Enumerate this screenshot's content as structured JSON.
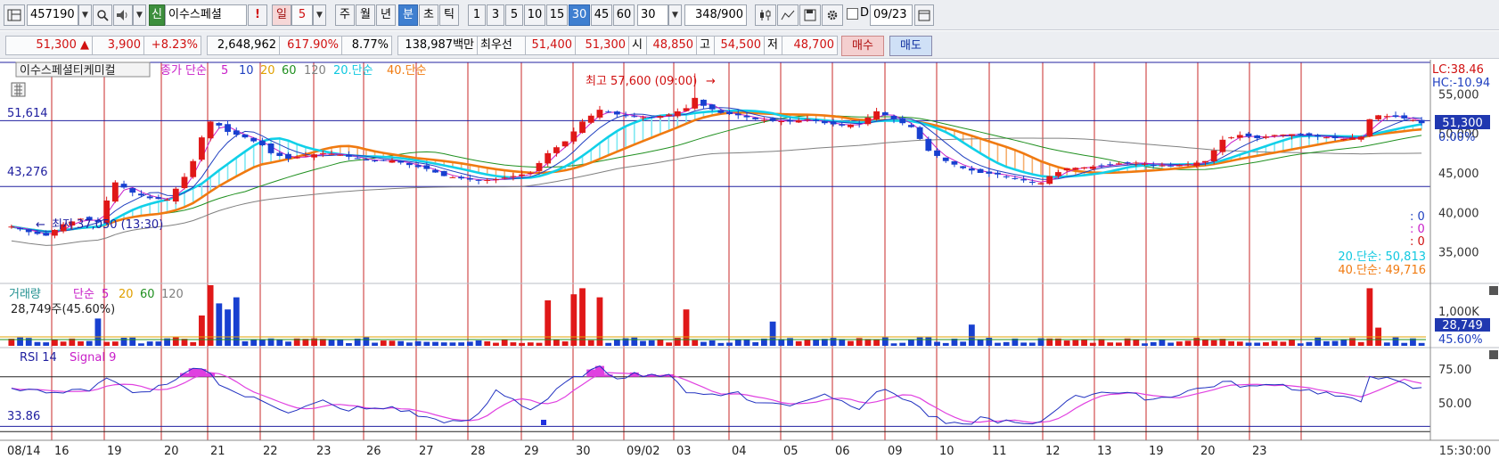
{
  "toolbar": {
    "stock_code": "457190",
    "stock_name": "이수스페셜티케미컬",
    "stock_name_short": "이수스페셜",
    "name_tag": "신",
    "alert": "!",
    "period_unit": "일",
    "period_value": "5",
    "periods": [
      "주",
      "월",
      "년",
      "분",
      "초",
      "틱"
    ],
    "minute_options": [
      "1",
      "3",
      "5",
      "10",
      "15",
      "30",
      "45",
      "60"
    ],
    "selected_minute": "30",
    "count_value": "30",
    "count_display": "348",
    "count_total": "/900",
    "checkbox_label": "D",
    "date_value": "09/23"
  },
  "quote": {
    "price": "51,300",
    "arrow": "▲",
    "change": "3,900",
    "change_pct": "+8.23%",
    "volume": "2,648,962",
    "volume_ratio": "617.90%",
    "turnover": "8.77%",
    "amount": "138,987백만",
    "best_label": "최우선",
    "ask": "51,400",
    "bid": "51,300",
    "open_label": "시",
    "open": "48,850",
    "high_label": "고",
    "high": "54,500",
    "low_label": "저",
    "low": "48,700",
    "buy_label": "매수",
    "sell_label": "매도"
  },
  "price_panel": {
    "legend": {
      "name": "이수스페셜티케미컬",
      "ma_label": "종가 단순",
      "ma_periods": [
        "5",
        "10",
        "20",
        "60",
        "120"
      ],
      "ma_colors": [
        "#c81ec8",
        "#2040c0",
        "#e0a000",
        "#209020",
        "#808080"
      ],
      "ma20_label": "20.단순",
      "ma40_label": "40.단순"
    },
    "lc_label": "LC:38.46",
    "hc_label": "HC:-10.94",
    "h_line_levels": [
      {
        "label": "51,614",
        "value": 51614
      },
      {
        "label": "43,276",
        "value": 43276
      }
    ],
    "current_price_label": "51,300",
    "current_pct_label": "0.00%",
    "y_axis_ticks": [
      "55,000",
      "50,000",
      "45,000",
      "40,000",
      "35,000"
    ],
    "annotation_high": "최고 57,600 (09:00)",
    "annotation_high_arrow": "→",
    "annotation_low": "최저 37,050 (13:30)",
    "annotation_low_arrow": "←",
    "right_markers": [
      ": 0",
      ": 0",
      ": 0"
    ],
    "ma20_value_label": "20.단순: 50,813",
    "ma40_value_label": "40.단순: 49,716"
  },
  "volume_panel": {
    "legend": {
      "label": "거래량",
      "ma_label": "단순",
      "ma_periods": [
        "5",
        "20",
        "60",
        "120"
      ],
      "ma_colors": [
        "#c81ec8",
        "#e0a000",
        "#209020",
        "#808080"
      ]
    },
    "current_volume": "28,749주(45.60%)",
    "y_axis_tick": "1,000K",
    "current_volume_label": "28,749",
    "current_pct_label": "45.60%"
  },
  "rsi_panel": {
    "legend": {
      "rsi_label": "RSI 14",
      "signal_label": "Signal 9"
    },
    "current_value": "33.86",
    "y_axis_ticks": [
      "75.00",
      "50.00"
    ]
  },
  "x_axis": {
    "labels": [
      "08/14",
      "16",
      "19",
      "20",
      "21",
      "22",
      "23",
      "26",
      "27",
      "28",
      "29",
      "30",
      "09/02",
      "03",
      "04",
      "05",
      "06",
      "09",
      "10",
      "11",
      "12",
      "13",
      "19",
      "20",
      "23"
    ],
    "time_label": "15:30:00"
  },
  "chart_data": {
    "type": "candlestick",
    "series": [
      {
        "name": "종가 단순 5"
      },
      {
        "name": "종가 단순 10"
      },
      {
        "name": "종가 단순 20"
      },
      {
        "name": "종가 단순 60"
      },
      {
        "name": "종가 단순 120"
      },
      {
        "name": "20.단순"
      },
      {
        "name": "40.단순"
      }
    ],
    "price_path": [
      [
        0,
        38200
      ],
      [
        2,
        37500
      ],
      [
        4,
        37050
      ],
      [
        6,
        38500
      ],
      [
        8,
        39200
      ],
      [
        10,
        38800
      ],
      [
        11,
        41500
      ],
      [
        12,
        43800
      ],
      [
        14,
        42500
      ],
      [
        16,
        41800
      ],
      [
        18,
        41600
      ],
      [
        19,
        43000
      ],
      [
        20,
        44500
      ],
      [
        21,
        46500
      ],
      [
        22,
        49500
      ],
      [
        23,
        51500
      ],
      [
        24,
        51000
      ],
      [
        25,
        50200
      ],
      [
        27,
        49500
      ],
      [
        29,
        48500
      ],
      [
        30,
        47500
      ],
      [
        32,
        46800
      ],
      [
        34,
        47200
      ],
      [
        36,
        47500
      ],
      [
        38,
        47300
      ],
      [
        40,
        46800
      ],
      [
        42,
        46500
      ],
      [
        44,
        46600
      ],
      [
        46,
        46000
      ],
      [
        48,
        45500
      ],
      [
        50,
        44600
      ],
      [
        52,
        44300
      ],
      [
        54,
        44000
      ],
      [
        56,
        44200
      ],
      [
        58,
        44600
      ],
      [
        60,
        45000
      ],
      [
        62,
        47500
      ],
      [
        64,
        49000
      ],
      [
        66,
        51500
      ],
      [
        68,
        53000
      ],
      [
        70,
        52400
      ],
      [
        72,
        52100
      ],
      [
        74,
        52000
      ],
      [
        76,
        52400
      ],
      [
        78,
        53200
      ],
      [
        79,
        54500
      ],
      [
        80,
        53500
      ],
      [
        82,
        52600
      ],
      [
        84,
        52300
      ],
      [
        86,
        51800
      ],
      [
        88,
        51600
      ],
      [
        90,
        51500
      ],
      [
        92,
        51800
      ],
      [
        94,
        51300
      ],
      [
        96,
        51000
      ],
      [
        98,
        51200
      ],
      [
        100,
        52800
      ],
      [
        102,
        51800
      ],
      [
        104,
        50800
      ],
      [
        105,
        49300
      ],
      [
        106,
        47800
      ],
      [
        108,
        46500
      ],
      [
        110,
        45600
      ],
      [
        112,
        45000
      ],
      [
        114,
        44800
      ],
      [
        116,
        44300
      ],
      [
        118,
        43800
      ],
      [
        119,
        43700
      ],
      [
        120,
        44600
      ],
      [
        122,
        45600
      ],
      [
        124,
        45700
      ],
      [
        126,
        45900
      ],
      [
        128,
        46200
      ],
      [
        130,
        46300
      ],
      [
        132,
        46000
      ],
      [
        134,
        45900
      ],
      [
        136,
        46100
      ],
      [
        138,
        46500
      ],
      [
        140,
        49200
      ],
      [
        142,
        49800
      ],
      [
        144,
        49400
      ],
      [
        146,
        49800
      ],
      [
        148,
        49900
      ],
      [
        150,
        49700
      ],
      [
        152,
        49500
      ],
      [
        154,
        49300
      ],
      [
        156,
        49600
      ],
      [
        157,
        51800
      ],
      [
        158,
        52300
      ],
      [
        160,
        52100
      ],
      [
        162,
        51700
      ],
      [
        163,
        51300
      ]
    ],
    "period_markers": {
      "high": 57600,
      "high_time": "09:00",
      "low": 37050,
      "low_time": "13:30"
    },
    "rsi_path": [
      [
        0,
        62
      ],
      [
        3,
        60
      ],
      [
        5,
        57
      ],
      [
        7,
        62
      ],
      [
        9,
        60
      ],
      [
        11,
        68
      ],
      [
        13,
        62
      ],
      [
        15,
        58
      ],
      [
        17,
        62
      ],
      [
        19,
        66
      ],
      [
        20,
        72
      ],
      [
        22,
        77
      ],
      [
        24,
        66
      ],
      [
        26,
        58
      ],
      [
        28,
        54
      ],
      [
        30,
        50
      ],
      [
        32,
        45
      ],
      [
        34,
        48
      ],
      [
        36,
        52
      ],
      [
        38,
        46
      ],
      [
        40,
        47
      ],
      [
        42,
        46
      ],
      [
        44,
        48
      ],
      [
        46,
        44
      ],
      [
        48,
        40
      ],
      [
        50,
        38
      ],
      [
        52,
        36
      ],
      [
        54,
        42
      ],
      [
        56,
        60
      ],
      [
        58,
        54
      ],
      [
        60,
        46
      ],
      [
        62,
        54
      ],
      [
        64,
        65
      ],
      [
        66,
        72
      ],
      [
        68,
        76
      ],
      [
        70,
        70
      ],
      [
        72,
        72
      ],
      [
        74,
        72
      ],
      [
        76,
        70
      ],
      [
        78,
        60
      ],
      [
        80,
        58
      ],
      [
        82,
        56
      ],
      [
        84,
        60
      ],
      [
        86,
        50
      ],
      [
        88,
        52
      ],
      [
        90,
        48
      ],
      [
        92,
        54
      ],
      [
        94,
        58
      ],
      [
        96,
        52
      ],
      [
        98,
        48
      ],
      [
        100,
        60
      ],
      [
        102,
        58
      ],
      [
        104,
        52
      ],
      [
        106,
        42
      ],
      [
        108,
        36
      ],
      [
        110,
        34
      ],
      [
        112,
        40
      ],
      [
        114,
        38
      ],
      [
        116,
        36
      ],
      [
        118,
        34
      ],
      [
        120,
        42
      ],
      [
        122,
        54
      ],
      [
        124,
        56
      ],
      [
        126,
        60
      ],
      [
        128,
        58
      ],
      [
        130,
        56
      ],
      [
        132,
        54
      ],
      [
        134,
        56
      ],
      [
        136,
        60
      ],
      [
        138,
        62
      ],
      [
        140,
        66
      ],
      [
        142,
        64
      ],
      [
        144,
        62
      ],
      [
        146,
        66
      ],
      [
        148,
        62
      ],
      [
        150,
        60
      ],
      [
        152,
        58
      ],
      [
        154,
        54
      ],
      [
        156,
        52
      ],
      [
        157,
        72
      ],
      [
        158,
        70
      ],
      [
        160,
        66
      ],
      [
        162,
        62
      ],
      [
        163,
        61
      ]
    ],
    "y_range": [
      31000,
      59000
    ],
    "rsi_range": [
      25,
      90
    ],
    "rsi_lines": [
      70,
      30
    ],
    "volume_spikes": [
      [
        10,
        0.45
      ],
      [
        22,
        0.5
      ],
      [
        23,
        1.0
      ],
      [
        24,
        0.7
      ],
      [
        25,
        0.6
      ],
      [
        26,
        0.8
      ],
      [
        62,
        0.75
      ],
      [
        65,
        0.85
      ],
      [
        66,
        0.95
      ],
      [
        68,
        0.8
      ],
      [
        78,
        0.6
      ],
      [
        88,
        0.4
      ],
      [
        111,
        0.35
      ],
      [
        157,
        0.95
      ],
      [
        158,
        0.3
      ]
    ],
    "day_separators": [
      1,
      11,
      21,
      31,
      41,
      51,
      61,
      71,
      81,
      91,
      101,
      111,
      121,
      131,
      141,
      151,
      161,
      171,
      181,
      191,
      201,
      211,
      221,
      231,
      241,
      251,
      261,
      271,
      281,
      291,
      301,
      311,
      321,
      331,
      341,
      351,
      361,
      371,
      381,
      391,
      401,
      411,
      421,
      431,
      441,
      451,
      461,
      471,
      481,
      491,
      501,
      511,
      521,
      531,
      541,
      551,
      561,
      571,
      581,
      591,
      601
    ]
  }
}
